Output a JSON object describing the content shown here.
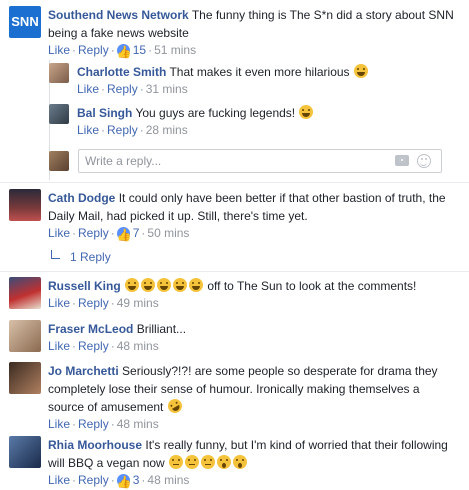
{
  "actions": {
    "like": "Like",
    "reply": "Reply"
  },
  "comments": [
    {
      "name": "Southend News Network",
      "text": "The funny thing is The S*n did a story about SNN being a fake news website",
      "likes": "15",
      "time": "51 mins",
      "avatar_text": "SNN"
    },
    {
      "name": "Charlotte Smith",
      "text": "That makes it even more hilarious",
      "time": "31 mins"
    },
    {
      "name": "Bal Singh",
      "text": "You guys are fucking legends!",
      "time": "28 mins"
    },
    {
      "name": "Cath Dodge",
      "text": "It could only have been better if that other bastion of truth, the Daily Mail, had picked it up. Still, there's time yet.",
      "likes": "7",
      "time": "50 mins"
    },
    {
      "name": "Russell King",
      "text": "off to The Sun to look at the comments!",
      "time": "49 mins"
    },
    {
      "name": "Fraser McLeod",
      "text": "Brilliant...",
      "time": "48 mins"
    },
    {
      "name": "Jo Marchetti",
      "text": "Seriously?!?! are some people so desperate for drama they completely lose their sense of humour. Ironically making themselves a source of amusement",
      "time": "48 mins"
    },
    {
      "name": "Rhia Moorhouse",
      "text": "It's really funny, but I'm kind of worried that their following will BBQ a vegan now",
      "likes": "3",
      "time": "48 mins"
    }
  ],
  "reply_box": {
    "placeholder": "Write a reply..."
  },
  "replies_link": "1 Reply"
}
